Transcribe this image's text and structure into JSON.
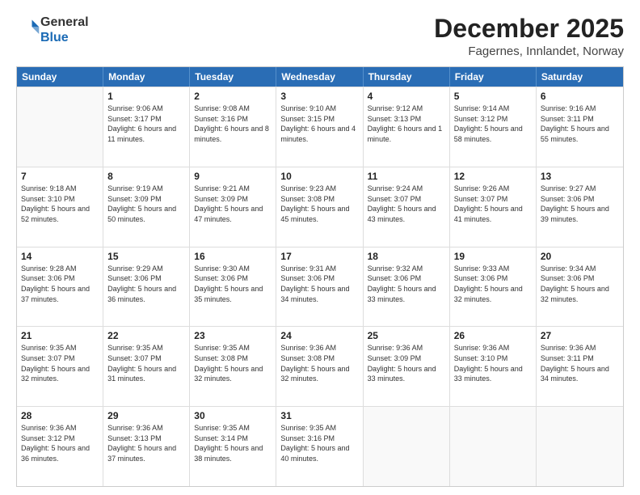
{
  "header": {
    "logo_line1": "General",
    "logo_line2": "Blue",
    "month": "December 2025",
    "location": "Fagernes, Innlandet, Norway"
  },
  "days_of_week": [
    "Sunday",
    "Monday",
    "Tuesday",
    "Wednesday",
    "Thursday",
    "Friday",
    "Saturday"
  ],
  "weeks": [
    [
      {
        "day": "",
        "empty": true
      },
      {
        "day": "1",
        "sunrise": "9:06 AM",
        "sunset": "3:17 PM",
        "daylight": "6 hours and 11 minutes."
      },
      {
        "day": "2",
        "sunrise": "9:08 AM",
        "sunset": "3:16 PM",
        "daylight": "6 hours and 8 minutes."
      },
      {
        "day": "3",
        "sunrise": "9:10 AM",
        "sunset": "3:15 PM",
        "daylight": "6 hours and 4 minutes."
      },
      {
        "day": "4",
        "sunrise": "9:12 AM",
        "sunset": "3:13 PM",
        "daylight": "6 hours and 1 minute."
      },
      {
        "day": "5",
        "sunrise": "9:14 AM",
        "sunset": "3:12 PM",
        "daylight": "5 hours and 58 minutes."
      },
      {
        "day": "6",
        "sunrise": "9:16 AM",
        "sunset": "3:11 PM",
        "daylight": "5 hours and 55 minutes."
      }
    ],
    [
      {
        "day": "7",
        "sunrise": "9:18 AM",
        "sunset": "3:10 PM",
        "daylight": "5 hours and 52 minutes."
      },
      {
        "day": "8",
        "sunrise": "9:19 AM",
        "sunset": "3:09 PM",
        "daylight": "5 hours and 50 minutes."
      },
      {
        "day": "9",
        "sunrise": "9:21 AM",
        "sunset": "3:09 PM",
        "daylight": "5 hours and 47 minutes."
      },
      {
        "day": "10",
        "sunrise": "9:23 AM",
        "sunset": "3:08 PM",
        "daylight": "5 hours and 45 minutes."
      },
      {
        "day": "11",
        "sunrise": "9:24 AM",
        "sunset": "3:07 PM",
        "daylight": "5 hours and 43 minutes."
      },
      {
        "day": "12",
        "sunrise": "9:26 AM",
        "sunset": "3:07 PM",
        "daylight": "5 hours and 41 minutes."
      },
      {
        "day": "13",
        "sunrise": "9:27 AM",
        "sunset": "3:06 PM",
        "daylight": "5 hours and 39 minutes."
      }
    ],
    [
      {
        "day": "14",
        "sunrise": "9:28 AM",
        "sunset": "3:06 PM",
        "daylight": "5 hours and 37 minutes."
      },
      {
        "day": "15",
        "sunrise": "9:29 AM",
        "sunset": "3:06 PM",
        "daylight": "5 hours and 36 minutes."
      },
      {
        "day": "16",
        "sunrise": "9:30 AM",
        "sunset": "3:06 PM",
        "daylight": "5 hours and 35 minutes."
      },
      {
        "day": "17",
        "sunrise": "9:31 AM",
        "sunset": "3:06 PM",
        "daylight": "5 hours and 34 minutes."
      },
      {
        "day": "18",
        "sunrise": "9:32 AM",
        "sunset": "3:06 PM",
        "daylight": "5 hours and 33 minutes."
      },
      {
        "day": "19",
        "sunrise": "9:33 AM",
        "sunset": "3:06 PM",
        "daylight": "5 hours and 32 minutes."
      },
      {
        "day": "20",
        "sunrise": "9:34 AM",
        "sunset": "3:06 PM",
        "daylight": "5 hours and 32 minutes."
      }
    ],
    [
      {
        "day": "21",
        "sunrise": "9:35 AM",
        "sunset": "3:07 PM",
        "daylight": "5 hours and 32 minutes."
      },
      {
        "day": "22",
        "sunrise": "9:35 AM",
        "sunset": "3:07 PM",
        "daylight": "5 hours and 31 minutes."
      },
      {
        "day": "23",
        "sunrise": "9:35 AM",
        "sunset": "3:08 PM",
        "daylight": "5 hours and 32 minutes."
      },
      {
        "day": "24",
        "sunrise": "9:36 AM",
        "sunset": "3:08 PM",
        "daylight": "5 hours and 32 minutes."
      },
      {
        "day": "25",
        "sunrise": "9:36 AM",
        "sunset": "3:09 PM",
        "daylight": "5 hours and 33 minutes."
      },
      {
        "day": "26",
        "sunrise": "9:36 AM",
        "sunset": "3:10 PM",
        "daylight": "5 hours and 33 minutes."
      },
      {
        "day": "27",
        "sunrise": "9:36 AM",
        "sunset": "3:11 PM",
        "daylight": "5 hours and 34 minutes."
      }
    ],
    [
      {
        "day": "28",
        "sunrise": "9:36 AM",
        "sunset": "3:12 PM",
        "daylight": "5 hours and 36 minutes."
      },
      {
        "day": "29",
        "sunrise": "9:36 AM",
        "sunset": "3:13 PM",
        "daylight": "5 hours and 37 minutes."
      },
      {
        "day": "30",
        "sunrise": "9:35 AM",
        "sunset": "3:14 PM",
        "daylight": "5 hours and 38 minutes."
      },
      {
        "day": "31",
        "sunrise": "9:35 AM",
        "sunset": "3:16 PM",
        "daylight": "5 hours and 40 minutes."
      },
      {
        "day": "",
        "empty": true
      },
      {
        "day": "",
        "empty": true
      },
      {
        "day": "",
        "empty": true
      }
    ]
  ]
}
